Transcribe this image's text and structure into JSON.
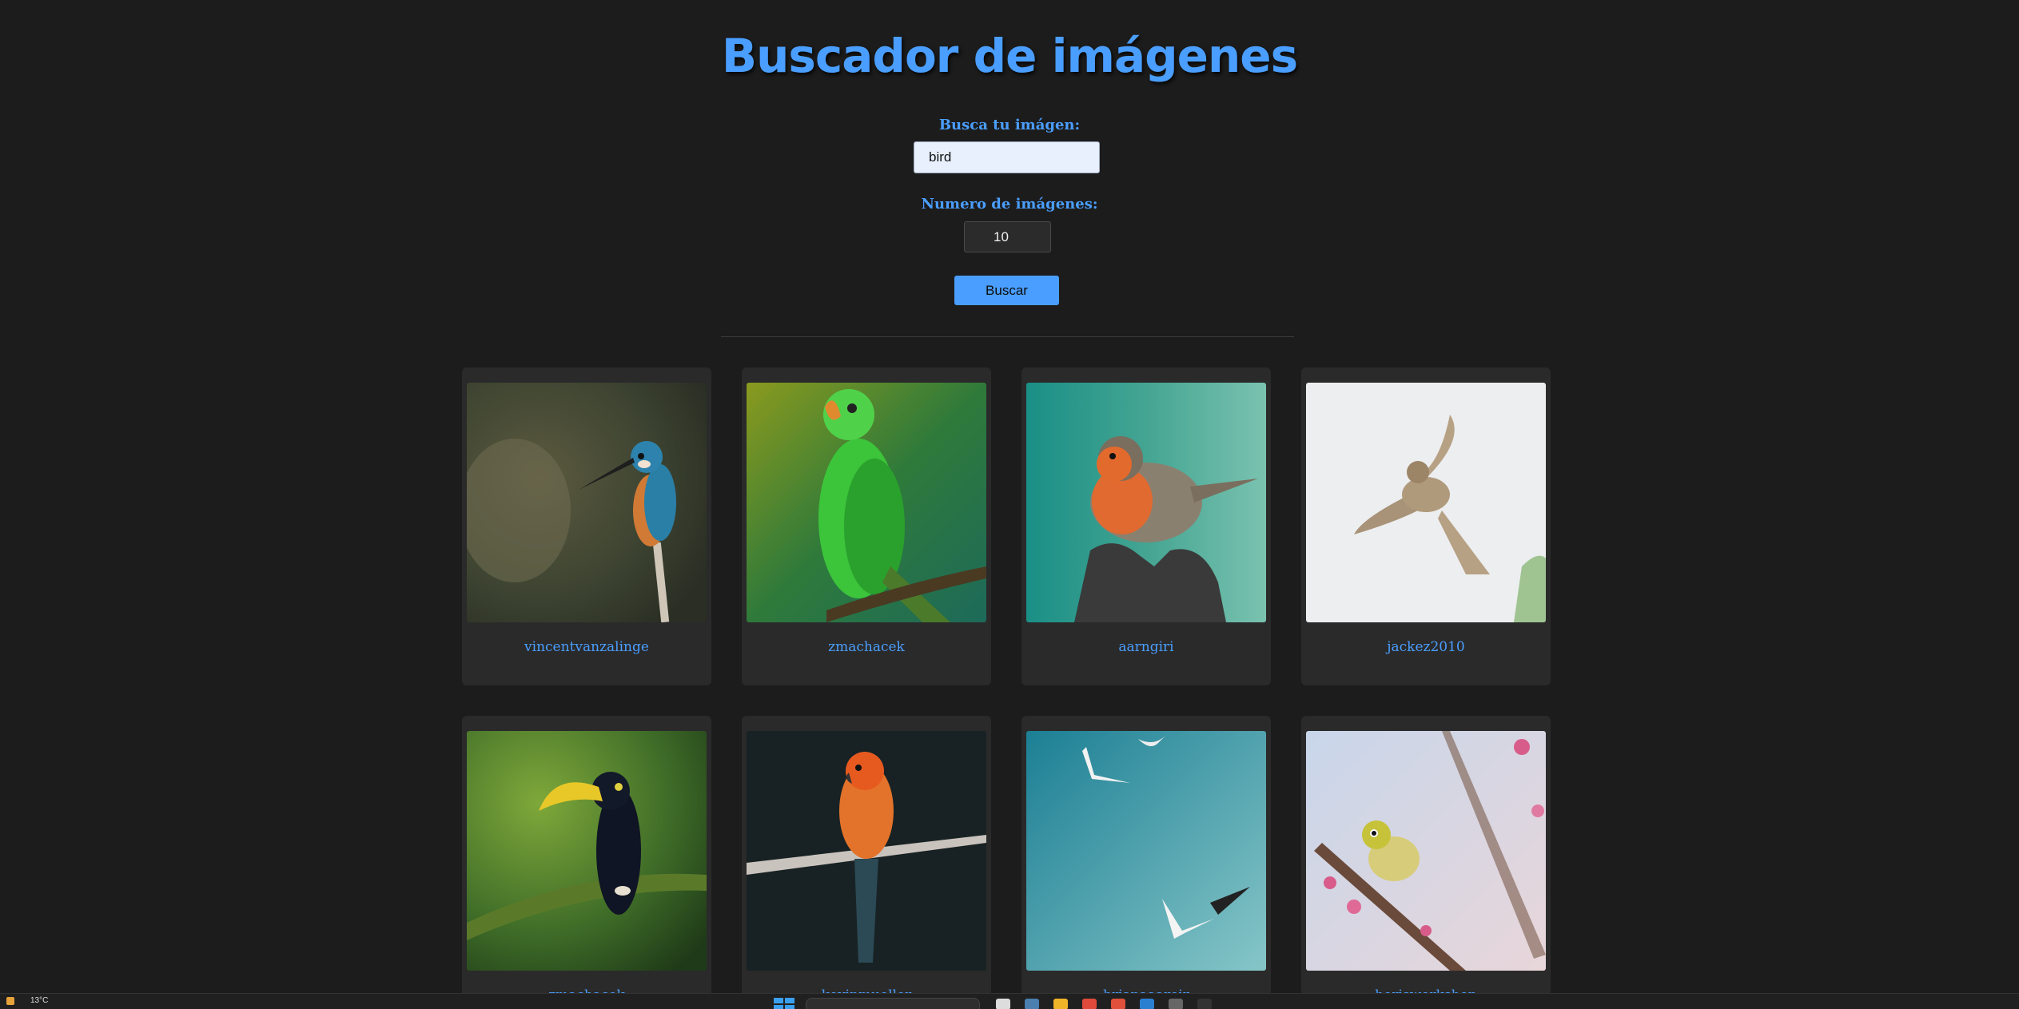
{
  "page": {
    "title": "Buscador de imágenes"
  },
  "form": {
    "search_label": "Busca tu imágen:",
    "search_value": "bird",
    "count_label": "Numero de imágenes:",
    "count_value": "10",
    "submit_label": "Buscar"
  },
  "results": [
    {
      "author": "vincentvanzalinge",
      "subject": "kingfisher"
    },
    {
      "author": "zmachacek",
      "subject": "green parakeet"
    },
    {
      "author": "aarngiri",
      "subject": "robin"
    },
    {
      "author": "jackez2010",
      "subject": "sparrow in flight"
    },
    {
      "author": "zmachacek",
      "subject": "toucan"
    },
    {
      "author": "kevinmueller",
      "subject": "sun conure"
    },
    {
      "author": "brianaaareir",
      "subject": "seagulls"
    },
    {
      "author": "borisworkshop",
      "subject": "white-eye on blossom"
    }
  ],
  "taskbar": {
    "temperature": "13°C",
    "clock": ""
  },
  "colors": {
    "accent": "#4a9eff",
    "background": "#1c1c1c",
    "card": "#2a2a2a"
  }
}
